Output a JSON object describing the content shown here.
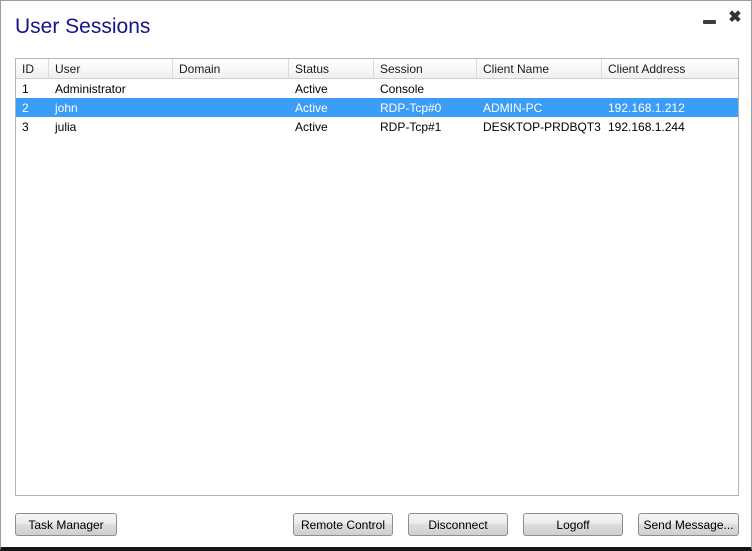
{
  "window": {
    "title": "User Sessions",
    "controls": {
      "minimize_icon": "minimize",
      "close_icon": "close",
      "close_glyph": "✖"
    }
  },
  "table": {
    "columns": [
      {
        "label": "ID"
      },
      {
        "label": "User"
      },
      {
        "label": "Domain"
      },
      {
        "label": "Status"
      },
      {
        "label": "Session"
      },
      {
        "label": "Client Name"
      },
      {
        "label": "Client Address"
      }
    ],
    "rows": [
      {
        "id": "1",
        "user": "Administrator",
        "domain": "",
        "status": "Active",
        "session": "Console",
        "client_name": "",
        "client_address": "",
        "selected": false
      },
      {
        "id": "2",
        "user": "john",
        "domain": "",
        "status": "Active",
        "session": "RDP-Tcp#0",
        "client_name": "ADMIN-PC",
        "client_address": "192.168.1.212",
        "selected": true
      },
      {
        "id": "3",
        "user": "julia",
        "domain": "",
        "status": "Active",
        "session": "RDP-Tcp#1",
        "client_name": "DESKTOP-PRDBQT3",
        "client_address": "192.168.1.244",
        "selected": false
      }
    ]
  },
  "buttons": [
    {
      "label": "Task Manager"
    },
    {
      "label": "Remote Control"
    },
    {
      "label": "Disconnect"
    },
    {
      "label": "Logoff"
    },
    {
      "label": "Send Message..."
    }
  ],
  "colors": {
    "title_text": "#14148C",
    "selection_background": "#3B9DF6",
    "selection_text": "#FFFFFF",
    "window_border": "#9C9C9C",
    "window_bottom_edge": "#161616",
    "table_border": "#B4B4B4"
  }
}
